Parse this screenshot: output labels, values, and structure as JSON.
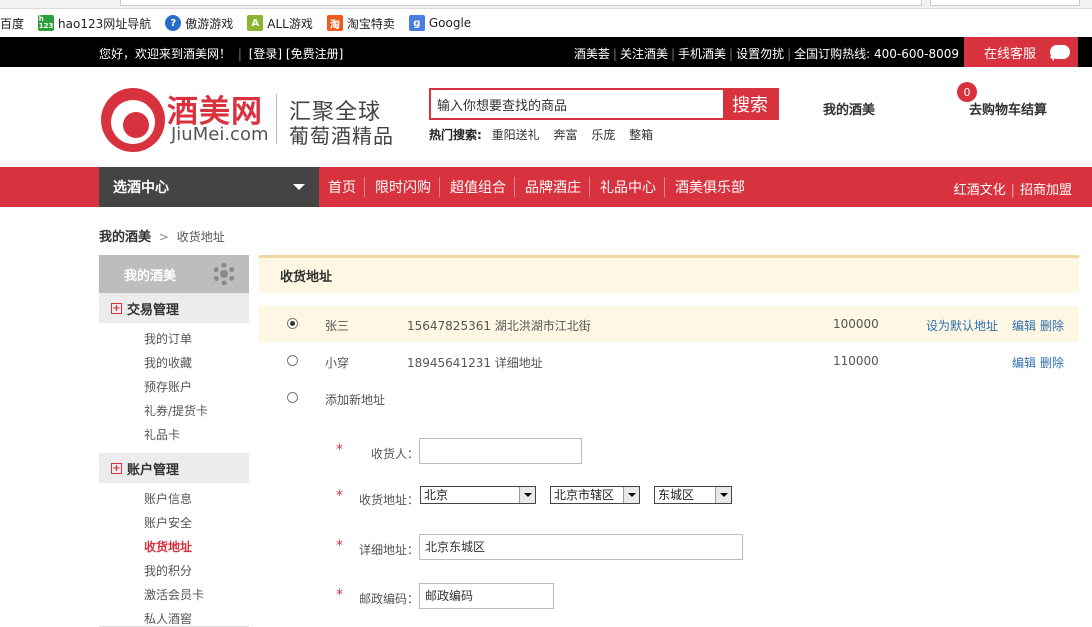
{
  "bookmarks": [
    {
      "label": "百度",
      "icon": "baidu-icon",
      "color": "#ffffff"
    },
    {
      "label": "hao123网址导航",
      "icon": "hao123-icon",
      "color": "#2e9e38"
    },
    {
      "label": "傲游游戏",
      "icon": "maxthon-game-icon",
      "color": "#2a6cc9"
    },
    {
      "label": "ALL游戏",
      "icon": "all-games-icon",
      "color": "#8ab530"
    },
    {
      "label": "淘宝特卖",
      "icon": "taobao-icon",
      "color": "#f05a1a"
    },
    {
      "label": "Google",
      "icon": "google-icon",
      "color": "#4a7de0"
    }
  ],
  "topbar": {
    "welcome": "您好，欢迎来到酒美网！",
    "login": "[登录]",
    "register": "[免费注册]",
    "links": [
      "酒美荟",
      "关注酒美",
      "手机酒美",
      "设置勿扰",
      "全国订购热线: 400-600-8009"
    ],
    "service": "在线客服"
  },
  "header": {
    "logo_cn": "酒美网",
    "logo_en": "JiuMei.com",
    "slogan1": "汇聚全球",
    "slogan2": "葡萄酒精品",
    "search_placeholder": "输入你想要查找的商品",
    "search_button": "搜索",
    "hot_label": "热门搜索:",
    "hot_keywords": [
      "重阳送礼",
      "奔富",
      "乐庞",
      "整箱"
    ],
    "my_jiumei": "我的酒美",
    "cart_label": "去购物车结算",
    "cart_count": "0"
  },
  "nav": {
    "category": "选酒中心",
    "items": [
      "首页",
      "限时闪购",
      "超值组合",
      "品牌酒庄",
      "礼品中心",
      "酒美俱乐部"
    ],
    "right": [
      "红酒文化",
      "招商加盟"
    ]
  },
  "breadcrumb": {
    "home": "我的酒美",
    "current": "收货地址"
  },
  "sidebar": {
    "title": "我的酒美",
    "groups": [
      {
        "title": "交易管理",
        "items": [
          "我的订单",
          "我的收藏",
          "预存账户",
          "礼券/提货卡",
          "礼品卡"
        ]
      },
      {
        "title": "账户管理",
        "items": [
          "账户信息",
          "账户安全",
          "收货地址",
          "我的积分",
          "激活会员卡",
          "私人酒窖"
        ]
      }
    ],
    "active_item": "收货地址"
  },
  "main": {
    "title": "收货地址",
    "addresses": [
      {
        "name": "张三",
        "detail": "15647825361 湖北洪湖市江北街",
        "zip": "100000",
        "set_default": "设为默认地址",
        "edit": "编辑",
        "delete": "删除",
        "selected": true
      },
      {
        "name": "小穿",
        "detail": "18945641231 详细地址",
        "zip": "110000",
        "set_default": "",
        "edit": "编辑",
        "delete": "删除",
        "selected": false
      }
    ],
    "add_new": "添加新地址",
    "form": {
      "receiver_label": "收货人：",
      "receiver_value": "",
      "region_label": "收货地址：",
      "province": "北京",
      "city": "北京市辖区",
      "district": "东城区",
      "detail_label": "详细地址：",
      "detail_value": "北京东城区",
      "zip_label": "邮政编码：",
      "zip_value": "邮政编码"
    }
  },
  "colors": {
    "brand_red": "#d8323e",
    "link_blue": "#2f6fb2",
    "highlight": "#fdf7e4"
  }
}
